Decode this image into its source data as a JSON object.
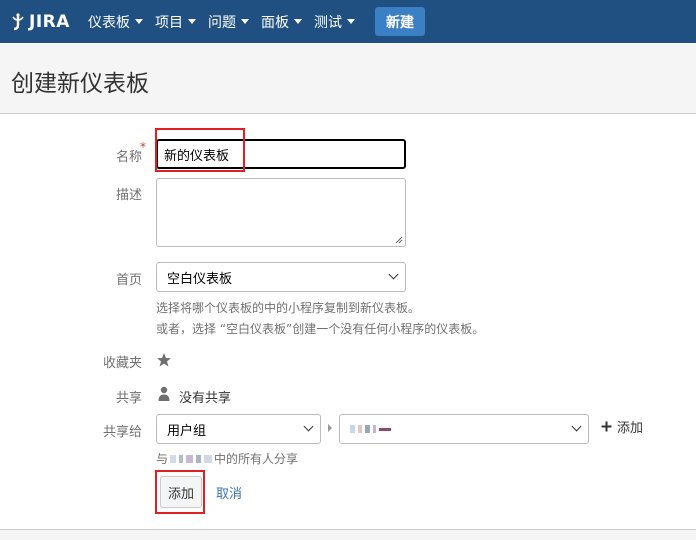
{
  "app": {
    "logo_text": "JIRA"
  },
  "nav": {
    "items": [
      {
        "label": "仪表板"
      },
      {
        "label": "项目"
      },
      {
        "label": "问题"
      },
      {
        "label": "面板"
      },
      {
        "label": "测试"
      }
    ],
    "create_label": "新建"
  },
  "page": {
    "title": "创建新仪表板"
  },
  "form": {
    "name_label": "名称",
    "name_required_mark": "*",
    "name_value": "新的仪表板",
    "description_label": "描述",
    "description_value": "",
    "start_label": "首页",
    "start_selected": "空白仪表板",
    "start_help_1": "选择将哪个仪表板的中的小程序复制到新仪表板。",
    "start_help_2": "或者，选择 “空白仪表板”创建一个没有任何小程序的仪表板。",
    "favourite_label": "收藏夹",
    "shares_label": "共享",
    "shares_value": "没有共享",
    "add_shares_label": "共享给",
    "share_type_selected": "用户组",
    "share_group_selected": "",
    "add_share_label": "添加",
    "share_hint_prefix": "与",
    "share_hint_suffix": "中的所有人分享",
    "submit_label": "添加",
    "cancel_label": "取消"
  },
  "icons": {
    "logo": "jira-logo-icon",
    "favourite": "star-icon",
    "shares": "person-icon",
    "add_share": "plus-icon"
  },
  "colors": {
    "header_bg": "#205081",
    "create_button_bg": "#3b7fc4",
    "link": "#3b73af",
    "required": "#d04437",
    "annotation_box": "#e02020"
  }
}
